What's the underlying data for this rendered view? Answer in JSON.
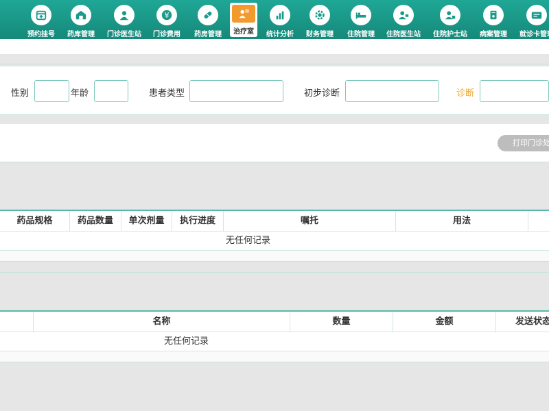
{
  "nav": {
    "items": [
      {
        "label": "预约挂号",
        "icon": "calendar-icon"
      },
      {
        "label": "药库管理",
        "icon": "warehouse-icon"
      },
      {
        "label": "门诊医生站",
        "icon": "doctor-icon"
      },
      {
        "label": "门诊费用",
        "icon": "yen-icon"
      },
      {
        "label": "药房管理",
        "icon": "pill-icon"
      },
      {
        "label": "治疗室",
        "icon": "treatment-icon"
      },
      {
        "label": "统计分析",
        "icon": "chart-icon"
      },
      {
        "label": "财务管理",
        "icon": "gear-icon"
      },
      {
        "label": "住院管理",
        "icon": "bed-icon"
      },
      {
        "label": "住院医生站",
        "icon": "inpatient-doctor-icon"
      },
      {
        "label": "住院护士站",
        "icon": "nurse-icon"
      },
      {
        "label": "病案管理",
        "icon": "record-icon"
      },
      {
        "label": "就诊卡管理",
        "icon": "card-icon"
      }
    ],
    "active_index": 5
  },
  "form": {
    "gender_label": "性别",
    "age_label": "年龄",
    "patient_type_label": "患者类型",
    "initial_diagnosis_label": "初步诊断",
    "diagnosis_label": "诊断",
    "gender_value": "",
    "age_value": "",
    "patient_type_value": "",
    "initial_diagnosis_value": "",
    "diagnosis_value": ""
  },
  "print_button": "打印门诊处方",
  "prescription_table": {
    "columns": [
      "药品规格",
      "药品数量",
      "单次剂量",
      "执行进度",
      "嘱托",
      "用法"
    ],
    "empty_text": "无任何记录"
  },
  "fee_table": {
    "columns": [
      "名称",
      "数量",
      "金额",
      "发送状态"
    ],
    "empty_text": "无任何记录"
  },
  "colors": {
    "nav_bg": "#1a9b8a",
    "active_icon_bg": "#f39a2e",
    "border_teal": "#57b8a9",
    "highlight_label": "#f0a93a"
  }
}
